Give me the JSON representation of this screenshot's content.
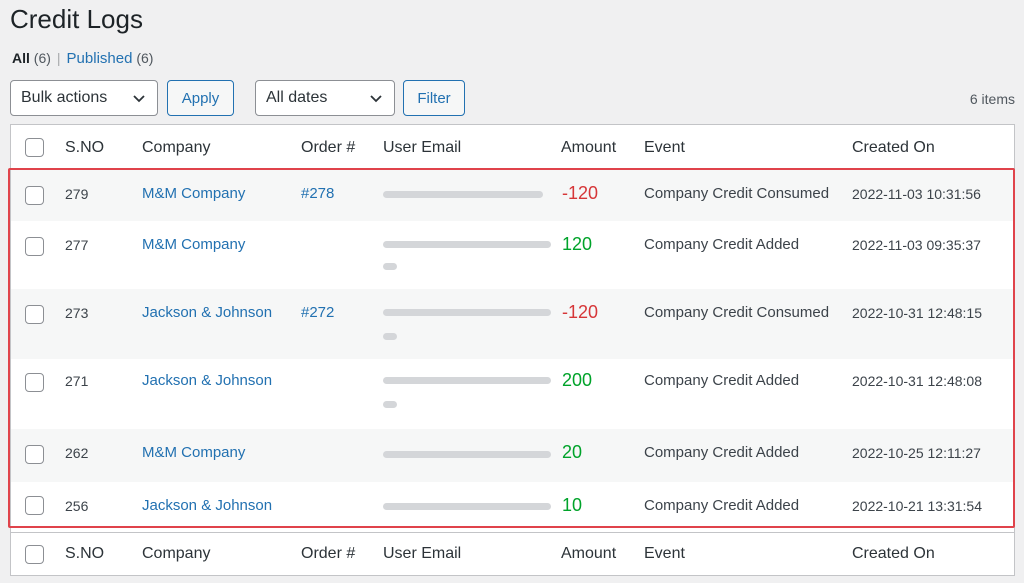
{
  "page": {
    "title": "Credit Logs"
  },
  "filters": {
    "all_label": "All",
    "all_count": "(6)",
    "separator": "|",
    "published_label": "Published",
    "published_count": "(6)"
  },
  "toolbar": {
    "bulk_actions": "Bulk actions",
    "apply": "Apply",
    "dates": "All dates",
    "filter": "Filter",
    "items_count": "6 items"
  },
  "table": {
    "columns": [
      "S.NO",
      "Company",
      "Order #",
      "User Email",
      "Amount",
      "Event",
      "Created On"
    ],
    "rows": [
      {
        "sno": "279",
        "company": "M&M Company",
        "order": "#278",
        "amount": "-120",
        "amount_sign": "negative",
        "event": "Company Credit Consumed",
        "created": "2022-11-03 10:31:56"
      },
      {
        "sno": "277",
        "company": "M&M Company",
        "order": "",
        "amount": "120",
        "amount_sign": "positive",
        "event": "Company Credit Added",
        "created": "2022-11-03 09:35:37"
      },
      {
        "sno": "273",
        "company": "Jackson & Johnson",
        "order": "#272",
        "amount": "-120",
        "amount_sign": "negative",
        "event": "Company Credit Consumed",
        "created": "2022-10-31 12:48:15"
      },
      {
        "sno": "271",
        "company": "Jackson & Johnson",
        "order": "",
        "amount": "200",
        "amount_sign": "positive",
        "event": "Company Credit Added",
        "created": "2022-10-31 12:48:08"
      },
      {
        "sno": "262",
        "company": "M&M Company",
        "order": "",
        "amount": "20",
        "amount_sign": "positive",
        "event": "Company Credit Added",
        "created": "2022-10-25 12:11:27"
      },
      {
        "sno": "256",
        "company": "Jackson & Johnson",
        "order": "",
        "amount": "10",
        "amount_sign": "positive",
        "event": "Company Credit Added",
        "created": "2022-10-21 13:31:54"
      }
    ]
  },
  "colors": {
    "link": "#2271b1",
    "negative": "#d63638",
    "positive": "#00a32a",
    "highlight": "#e0434b"
  },
  "icons": {
    "select_chevron": "chevron-down-icon"
  }
}
